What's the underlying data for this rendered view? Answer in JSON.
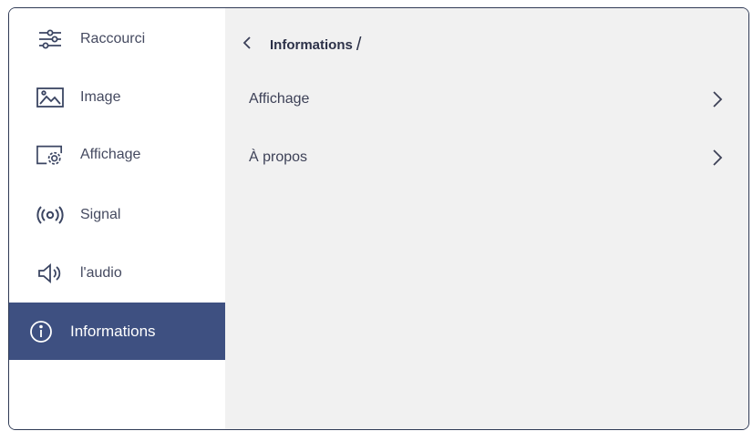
{
  "sidebar": {
    "items": [
      {
        "label": "Raccourci",
        "icon": "sliders-icon",
        "active": false
      },
      {
        "label": "Image",
        "icon": "image-icon",
        "active": false
      },
      {
        "label": "Affichage",
        "icon": "display-settings-icon",
        "active": false
      },
      {
        "label": "Signal",
        "icon": "signal-icon",
        "active": false
      },
      {
        "label": "l'audio",
        "icon": "speaker-icon",
        "active": false
      },
      {
        "label": "Informations",
        "icon": "info-icon",
        "active": true
      }
    ]
  },
  "main": {
    "header": {
      "back_icon": "chevron-left-icon",
      "title": "Informations",
      "separator": "/"
    },
    "rows": [
      {
        "label": "Affichage",
        "icon": "chevron-right-icon"
      },
      {
        "label": "À propos",
        "icon": "chevron-right-icon"
      }
    ]
  },
  "colors": {
    "active_bg": "#3e5081",
    "sidebar_bg": "#ffffff",
    "content_bg": "#f1f1f1",
    "text": "#454a60"
  }
}
